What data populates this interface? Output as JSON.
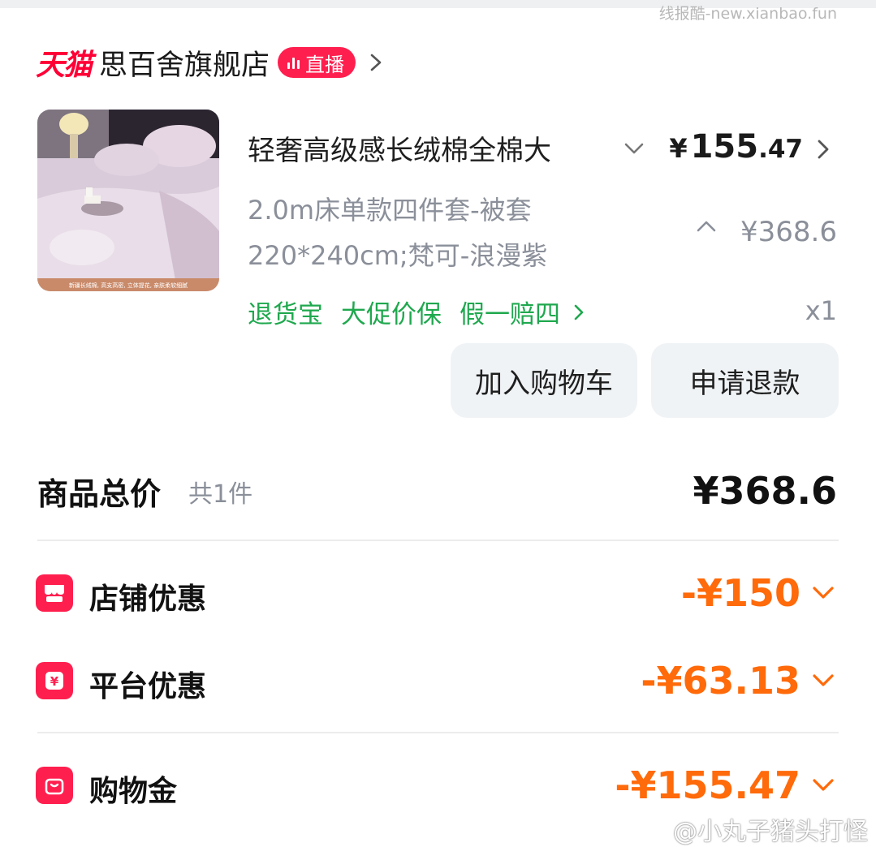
{
  "watermark_top": "线报酷-new.xianbao.fun",
  "store": {
    "platform": "天猫",
    "name": "思百舍旗舰店",
    "live_badge": "直播"
  },
  "product": {
    "title": "轻奢高级感长绒棉全棉大",
    "price_int": "155",
    "price_dec": ".47",
    "currency": "¥",
    "spec_line1": "2.0m床单款四件套-被套",
    "spec_line2": "220*240cm;梵可-浪漫紫",
    "original_price": "¥368.6",
    "tags": [
      "退货宝",
      "大促价保",
      "假一赔四"
    ],
    "quantity": "x1",
    "image_caption": "新疆长绒棉, 高支高密, 立体提花, 亲肤柔软细腻"
  },
  "actions": {
    "add_to_cart": "加入购物车",
    "refund": "申请退款"
  },
  "summary": {
    "label": "商品总价",
    "count": "共1件",
    "total": "¥368.6"
  },
  "discounts": [
    {
      "label": "店铺优惠",
      "amount": "-¥150",
      "icon": "shop-icon"
    },
    {
      "label": "平台优惠",
      "amount": "-¥63.13",
      "icon": "coupon-yen-icon"
    },
    {
      "label": "购物金",
      "amount": "-¥155.47",
      "icon": "wallet-bag-icon"
    }
  ],
  "watermark_bottom": "@小丸子猪头打怪",
  "colors": {
    "tmall_red": "#ff0036",
    "tag_green": "#1fa84e",
    "discount_orange": "#ff6a0a",
    "icon_red": "#ff1f4f"
  }
}
